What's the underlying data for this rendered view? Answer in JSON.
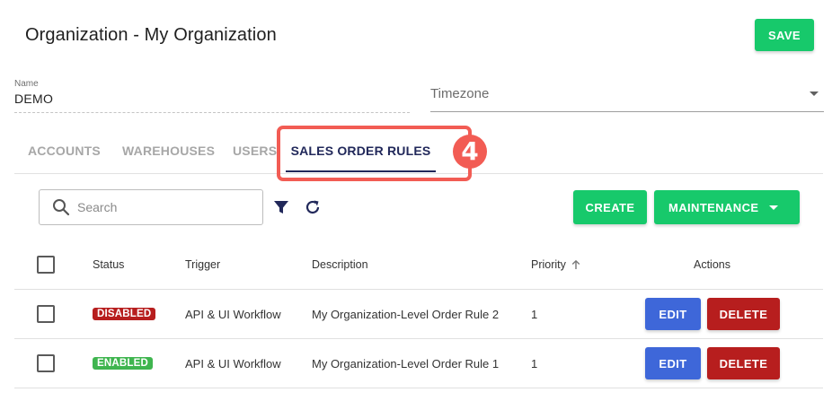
{
  "header": {
    "title": "Organization - My Organization",
    "save_label": "SAVE"
  },
  "form": {
    "name_label": "Name",
    "name_value": "DEMO",
    "timezone_placeholder": "Timezone"
  },
  "tabs": [
    {
      "label": "ACCOUNTS"
    },
    {
      "label": "WAREHOUSES"
    },
    {
      "label": "USERS"
    },
    {
      "label": "SALES ORDER RULES"
    }
  ],
  "annotation": {
    "step_number": "4",
    "color": "#f25c54"
  },
  "toolbar": {
    "search_placeholder": "Search",
    "create_label": "CREATE",
    "maintenance_label": "MAINTENANCE"
  },
  "table": {
    "columns": {
      "status": "Status",
      "trigger": "Trigger",
      "description": "Description",
      "priority": "Priority",
      "actions": "Actions"
    },
    "rows": [
      {
        "status": "DISABLED",
        "trigger": "API & UI Workflow",
        "description": "My Organization-Level Order Rule 2",
        "priority": "1",
        "edit_label": "EDIT",
        "delete_label": "DELETE"
      },
      {
        "status": "ENABLED",
        "trigger": "API & UI Workflow",
        "description": "My Organization-Level Order Rule 1",
        "priority": "1",
        "edit_label": "EDIT",
        "delete_label": "DELETE"
      }
    ]
  },
  "colors": {
    "primary_green": "#17c96b",
    "edit_blue": "#3e67d9",
    "delete_red": "#b71e1e",
    "enabled_green": "#3fb54f",
    "active_tab": "#21285a"
  },
  "icons": [
    "search-icon",
    "filter-icon",
    "refresh-icon",
    "sort-ascending-icon",
    "dropdown-arrow-icon"
  ]
}
